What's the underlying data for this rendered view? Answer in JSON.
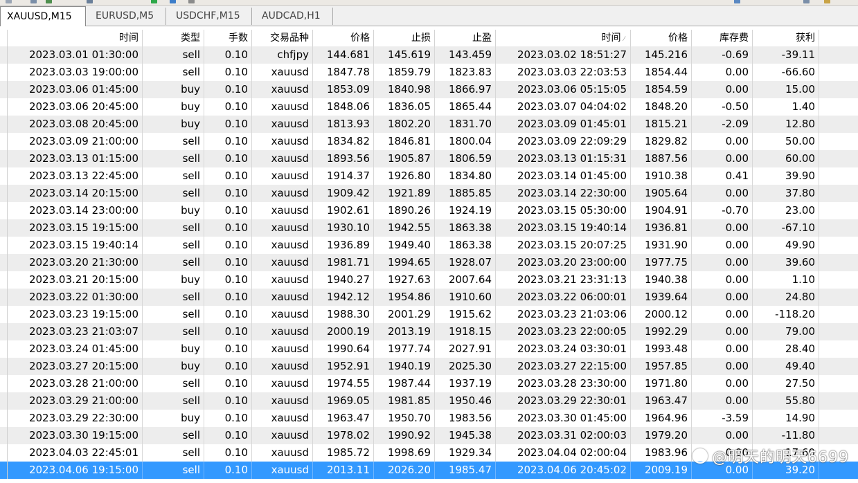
{
  "tabs": [
    {
      "label": "XAUUSD,M15",
      "active": true
    },
    {
      "label": "EURUSD,M5",
      "active": false
    },
    {
      "label": "USDCHF,M15",
      "active": false
    },
    {
      "label": "AUDCAD,H1",
      "active": false
    }
  ],
  "headers": {
    "open_time": "时间",
    "type": "类型",
    "lots": "手数",
    "symbol": "交易品种",
    "open_price": "价格",
    "sl": "止损",
    "tp": "止盈",
    "close_time": "时间",
    "close_price": "价格",
    "swap": "库存费",
    "profit": "获利"
  },
  "rows": [
    {
      "open_time": "2023.03.01 01:30:00",
      "type": "sell",
      "lots": "0.10",
      "symbol": "chfjpy",
      "open_price": "144.681",
      "sl": "145.619",
      "tp": "143.459",
      "close_time": "2023.03.02 18:51:27",
      "close_price": "145.216",
      "swap": "-0.69",
      "profit": "-39.11"
    },
    {
      "open_time": "2023.03.03 19:00:00",
      "type": "sell",
      "lots": "0.10",
      "symbol": "xauusd",
      "open_price": "1847.78",
      "sl": "1859.79",
      "tp": "1823.83",
      "close_time": "2023.03.03 22:03:53",
      "close_price": "1854.44",
      "swap": "0.00",
      "profit": "-66.60"
    },
    {
      "open_time": "2023.03.06 01:45:00",
      "type": "buy",
      "lots": "0.10",
      "symbol": "xauusd",
      "open_price": "1853.09",
      "sl": "1840.98",
      "tp": "1866.97",
      "close_time": "2023.03.06 05:15:05",
      "close_price": "1854.59",
      "swap": "0.00",
      "profit": "15.00"
    },
    {
      "open_time": "2023.03.06 20:45:00",
      "type": "buy",
      "lots": "0.10",
      "symbol": "xauusd",
      "open_price": "1848.06",
      "sl": "1836.05",
      "tp": "1865.44",
      "close_time": "2023.03.07 04:04:02",
      "close_price": "1848.20",
      "swap": "-0.50",
      "profit": "1.40"
    },
    {
      "open_time": "2023.03.08 20:45:00",
      "type": "buy",
      "lots": "0.10",
      "symbol": "xauusd",
      "open_price": "1813.93",
      "sl": "1802.20",
      "tp": "1831.70",
      "close_time": "2023.03.09 01:45:01",
      "close_price": "1815.21",
      "swap": "-2.09",
      "profit": "12.80"
    },
    {
      "open_time": "2023.03.09 21:00:00",
      "type": "sell",
      "lots": "0.10",
      "symbol": "xauusd",
      "open_price": "1834.82",
      "sl": "1846.81",
      "tp": "1800.04",
      "close_time": "2023.03.09 22:09:29",
      "close_price": "1829.82",
      "swap": "0.00",
      "profit": "50.00"
    },
    {
      "open_time": "2023.03.13 01:15:00",
      "type": "sell",
      "lots": "0.10",
      "symbol": "xauusd",
      "open_price": "1893.56",
      "sl": "1905.87",
      "tp": "1806.59",
      "close_time": "2023.03.13 01:15:31",
      "close_price": "1887.56",
      "swap": "0.00",
      "profit": "60.00"
    },
    {
      "open_time": "2023.03.13 22:45:00",
      "type": "sell",
      "lots": "0.10",
      "symbol": "xauusd",
      "open_price": "1914.37",
      "sl": "1926.80",
      "tp": "1834.80",
      "close_time": "2023.03.14 01:45:00",
      "close_price": "1910.38",
      "swap": "0.41",
      "profit": "39.90"
    },
    {
      "open_time": "2023.03.14 20:15:00",
      "type": "sell",
      "lots": "0.10",
      "symbol": "xauusd",
      "open_price": "1909.42",
      "sl": "1921.89",
      "tp": "1885.85",
      "close_time": "2023.03.14 22:30:00",
      "close_price": "1905.64",
      "swap": "0.00",
      "profit": "37.80"
    },
    {
      "open_time": "2023.03.14 23:00:00",
      "type": "buy",
      "lots": "0.10",
      "symbol": "xauusd",
      "open_price": "1902.61",
      "sl": "1890.26",
      "tp": "1924.19",
      "close_time": "2023.03.15 05:30:00",
      "close_price": "1904.91",
      "swap": "-0.70",
      "profit": "23.00"
    },
    {
      "open_time": "2023.03.15 19:15:00",
      "type": "sell",
      "lots": "0.10",
      "symbol": "xauusd",
      "open_price": "1930.10",
      "sl": "1942.55",
      "tp": "1863.38",
      "close_time": "2023.03.15 19:40:14",
      "close_price": "1936.81",
      "swap": "0.00",
      "profit": "-67.10"
    },
    {
      "open_time": "2023.03.15 19:40:14",
      "type": "sell",
      "lots": "0.10",
      "symbol": "xauusd",
      "open_price": "1936.89",
      "sl": "1949.40",
      "tp": "1863.38",
      "close_time": "2023.03.15 20:07:25",
      "close_price": "1931.90",
      "swap": "0.00",
      "profit": "49.90"
    },
    {
      "open_time": "2023.03.20 21:30:00",
      "type": "sell",
      "lots": "0.10",
      "symbol": "xauusd",
      "open_price": "1981.71",
      "sl": "1994.65",
      "tp": "1928.07",
      "close_time": "2023.03.20 23:00:00",
      "close_price": "1977.75",
      "swap": "0.00",
      "profit": "39.60"
    },
    {
      "open_time": "2023.03.21 20:15:00",
      "type": "buy",
      "lots": "0.10",
      "symbol": "xauusd",
      "open_price": "1940.27",
      "sl": "1927.63",
      "tp": "2007.64",
      "close_time": "2023.03.21 23:31:13",
      "close_price": "1940.38",
      "swap": "0.00",
      "profit": "1.10"
    },
    {
      "open_time": "2023.03.22 01:30:00",
      "type": "sell",
      "lots": "0.10",
      "symbol": "xauusd",
      "open_price": "1942.12",
      "sl": "1954.86",
      "tp": "1910.60",
      "close_time": "2023.03.22 06:00:01",
      "close_price": "1939.64",
      "swap": "0.00",
      "profit": "24.80"
    },
    {
      "open_time": "2023.03.23 19:15:00",
      "type": "sell",
      "lots": "0.10",
      "symbol": "xauusd",
      "open_price": "1988.30",
      "sl": "2001.29",
      "tp": "1915.62",
      "close_time": "2023.03.23 21:03:06",
      "close_price": "2000.12",
      "swap": "0.00",
      "profit": "-118.20"
    },
    {
      "open_time": "2023.03.23 21:03:07",
      "type": "sell",
      "lots": "0.10",
      "symbol": "xauusd",
      "open_price": "2000.19",
      "sl": "2013.19",
      "tp": "1918.15",
      "close_time": "2023.03.23 22:00:05",
      "close_price": "1992.29",
      "swap": "0.00",
      "profit": "79.00"
    },
    {
      "open_time": "2023.03.24 01:45:00",
      "type": "buy",
      "lots": "0.10",
      "symbol": "xauusd",
      "open_price": "1990.64",
      "sl": "1977.74",
      "tp": "2027.91",
      "close_time": "2023.03.24 03:30:01",
      "close_price": "1993.48",
      "swap": "0.00",
      "profit": "28.40"
    },
    {
      "open_time": "2023.03.27 20:15:00",
      "type": "buy",
      "lots": "0.10",
      "symbol": "xauusd",
      "open_price": "1952.91",
      "sl": "1940.19",
      "tp": "2025.30",
      "close_time": "2023.03.27 22:15:00",
      "close_price": "1957.85",
      "swap": "0.00",
      "profit": "49.40"
    },
    {
      "open_time": "2023.03.28 21:00:00",
      "type": "sell",
      "lots": "0.10",
      "symbol": "xauusd",
      "open_price": "1974.55",
      "sl": "1987.44",
      "tp": "1937.19",
      "close_time": "2023.03.28 23:30:00",
      "close_price": "1971.80",
      "swap": "0.00",
      "profit": "27.50"
    },
    {
      "open_time": "2023.03.29 21:00:00",
      "type": "sell",
      "lots": "0.10",
      "symbol": "xauusd",
      "open_price": "1969.05",
      "sl": "1981.85",
      "tp": "1950.46",
      "close_time": "2023.03.29 22:30:01",
      "close_price": "1963.47",
      "swap": "0.00",
      "profit": "55.80"
    },
    {
      "open_time": "2023.03.29 22:30:00",
      "type": "buy",
      "lots": "0.10",
      "symbol": "xauusd",
      "open_price": "1963.47",
      "sl": "1950.70",
      "tp": "1983.56",
      "close_time": "2023.03.30 01:45:00",
      "close_price": "1964.96",
      "swap": "-3.59",
      "profit": "14.90"
    },
    {
      "open_time": "2023.03.30 19:15:00",
      "type": "sell",
      "lots": "0.10",
      "symbol": "xauusd",
      "open_price": "1978.02",
      "sl": "1990.92",
      "tp": "1945.38",
      "close_time": "2023.03.31 02:00:03",
      "close_price": "1979.20",
      "swap": "0.00",
      "profit": "-11.80"
    },
    {
      "open_time": "2023.04.03 22:45:01",
      "type": "sell",
      "lots": "0.10",
      "symbol": "xauusd",
      "open_price": "1985.72",
      "sl": "1998.69",
      "tp": "1929.34",
      "close_time": "2023.04.04 02:00:04",
      "close_price": "1983.96",
      "swap": "0.00",
      "profit": "17.60"
    },
    {
      "open_time": "2023.04.06 19:15:00",
      "type": "sell",
      "lots": "0.10",
      "symbol": "xauusd",
      "open_price": "2013.11",
      "sl": "2026.20",
      "tp": "1985.47",
      "close_time": "2023.04.06 20:45:02",
      "close_price": "2009.19",
      "swap": "0.00",
      "profit": "39.20"
    }
  ],
  "watermark": "@明天的明天6699",
  "colors": {
    "selected_row": "#3399ff",
    "alt_row": "#ededed"
  }
}
